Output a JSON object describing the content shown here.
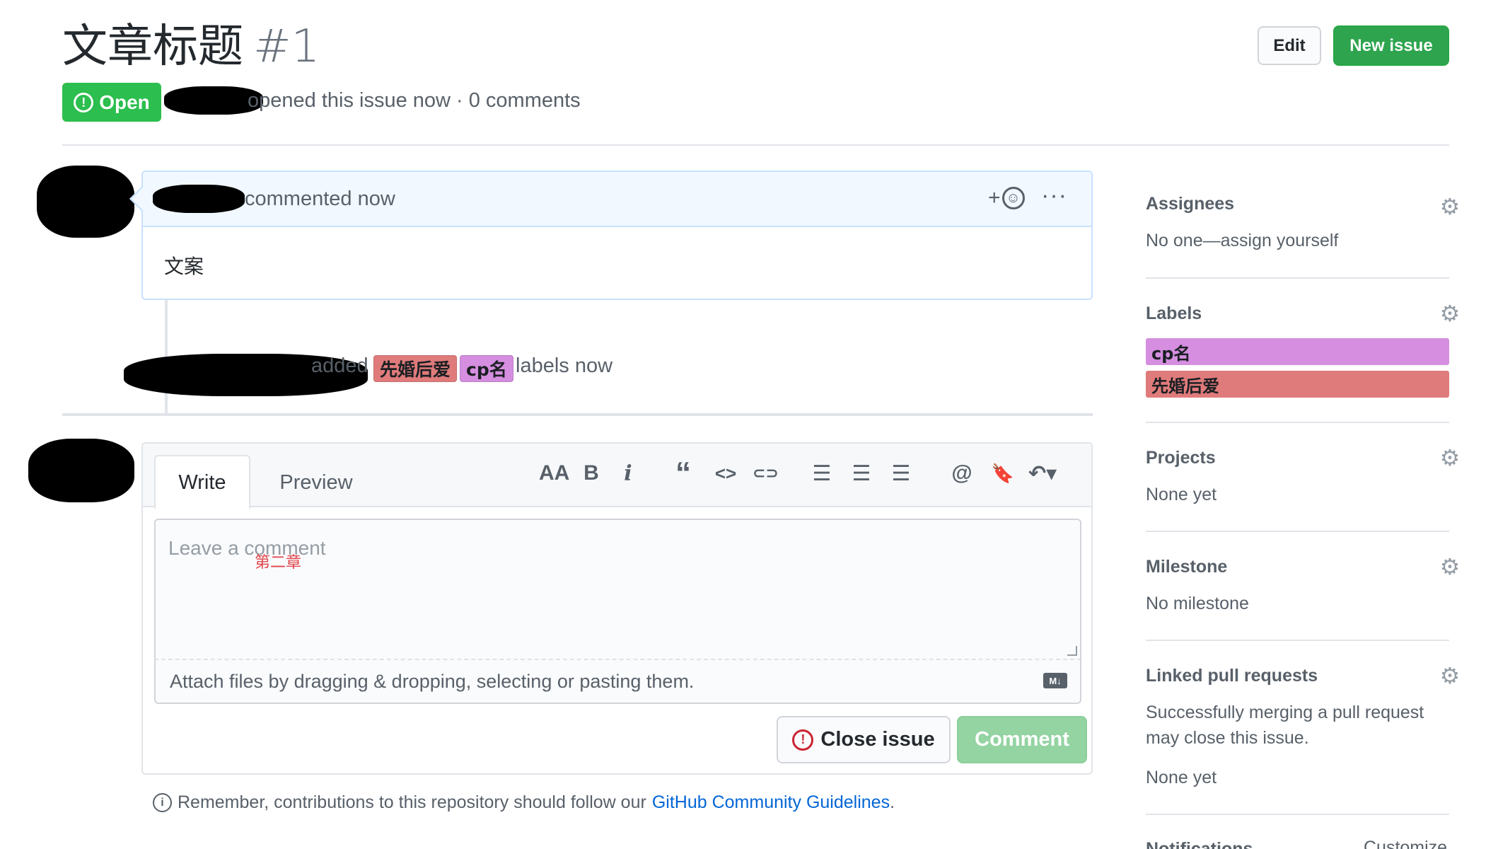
{
  "header": {
    "title": "文章标题",
    "issue_number": "#1",
    "edit_label": "Edit",
    "new_issue_label": "New issue",
    "status": "Open",
    "meta": "opened this issue now · 0 comments"
  },
  "comment": {
    "header_text": "commented now",
    "add_reaction": "+",
    "more": "···",
    "body": "文案"
  },
  "label_event": {
    "verb": "added",
    "labels": [
      {
        "name": "先婚后爱",
        "color": "#e07b7b"
      },
      {
        "name": "cp名",
        "color": "#d58ee0"
      }
    ],
    "suffix": "labels now"
  },
  "composer": {
    "tabs": [
      "Write",
      "Preview"
    ],
    "toolbar": {
      "heading": "AA",
      "bold": "B",
      "italic": "i",
      "quote": "“",
      "code": "<>",
      "link": "⊂⊃",
      "ul": "☰",
      "ol": "☰",
      "task": "☰",
      "mention": "@",
      "saved_reply": "🔖",
      "reply": "↶▾"
    },
    "placeholder": "Leave a comment",
    "overlay_text": "第二章",
    "attach_text": "Attach files by dragging & dropping, selecting or pasting them.",
    "md_badge": "M↓",
    "close_issue": "Close issue",
    "comment_button": "Comment"
  },
  "footer": {
    "remember_prefix": "Remember, contributions to this repository should follow our",
    "guidelines_link": "GitHub Community Guidelines",
    "suffix": "."
  },
  "sidebar": {
    "assignees": {
      "title": "Assignees",
      "value": "No one—assign yourself"
    },
    "labels": {
      "title": "Labels",
      "items": [
        {
          "name": "cp名",
          "color": "#d58ee0"
        },
        {
          "name": "先婚后爱",
          "color": "#e07b7b"
        }
      ]
    },
    "projects": {
      "title": "Projects",
      "value": "None yet"
    },
    "milestone": {
      "title": "Milestone",
      "value": "No milestone"
    },
    "linked_prs": {
      "title": "Linked pull requests",
      "line1": "Successfully merging a pull request",
      "line2": "may close this issue.",
      "value": "None yet"
    },
    "notifications": {
      "title": "Notifications",
      "customize": "Customize"
    }
  },
  "colors": {
    "green": "#2cbe4e",
    "blue_link": "#0366d6",
    "label_xh": "#e07b7b",
    "label_cp": "#d58ee0"
  }
}
